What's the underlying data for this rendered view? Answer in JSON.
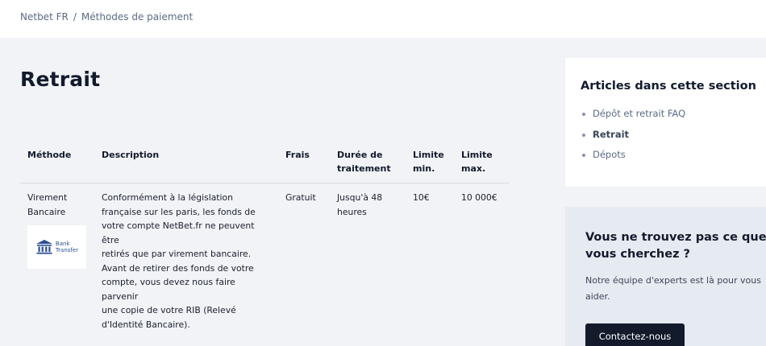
{
  "breadcrumb": {
    "home": "Netbet FR",
    "separator": "/",
    "current": "Méthodes de paiement"
  },
  "page": {
    "title": "Retrait"
  },
  "table": {
    "headers": {
      "method": "Méthode",
      "description": "Description",
      "fees": "Frais",
      "duration_line1": "Durée de",
      "duration_line2": "traitement",
      "min_line1": "Limite",
      "min_line2": "min.",
      "max_line1": "Limite",
      "max_line2": "max."
    },
    "rows": [
      {
        "method_line1": "Virement",
        "method_line2": "Bancaire",
        "logo_line1": "Bank",
        "logo_line2": "Transfer",
        "description_lines": [
          "Conformément à la législation",
          "française sur les paris, les fonds de",
          "votre compte NetBet.fr ne peuvent être",
          "retirés que par virement bancaire.",
          "Avant de retirer des fonds de votre",
          "compte, vous devez nous faire parvenir",
          "une copie de votre RIB (Relevé",
          "d'Identité Bancaire)."
        ],
        "fees": "Gratuit",
        "duration_line1": "Jusqu'à 48",
        "duration_line2": "heures",
        "min": "10€",
        "max": "10 000€"
      }
    ]
  },
  "sidebar": {
    "title": "Articles dans cette section",
    "items": [
      {
        "label": "Dépôt et retrait FAQ"
      },
      {
        "label": "Retrait"
      },
      {
        "label": "Dépots"
      }
    ]
  },
  "help": {
    "title_line1": "Vous ne trouvez pas ce que",
    "title_line2": "vous cherchez ?",
    "text_line1": "Notre équipe d'experts est là pour vous",
    "text_line2": "aider.",
    "button_label": "Contactez-nous"
  },
  "colors": {
    "background": "#f1f3f6",
    "text_dark": "#121a2c",
    "text_muted": "#5b6b85",
    "button_bg": "#121a2c",
    "help_bg": "#e6eaf1",
    "bank_logo_blue": "#2a4f93"
  }
}
